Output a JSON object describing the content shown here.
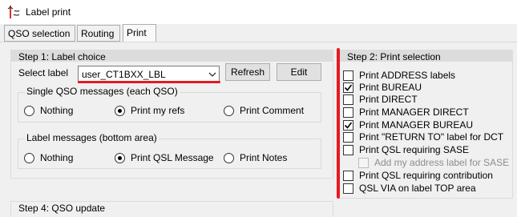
{
  "window": {
    "title": "Label print"
  },
  "tabs": [
    {
      "label": "QSO selection",
      "active": false
    },
    {
      "label": "Routing",
      "active": false
    },
    {
      "label": "Print",
      "active": true
    }
  ],
  "step1": {
    "title": "Step 1: Label choice",
    "select_label": "Select label",
    "selected": "user_CT1BXX_LBL",
    "refresh_label": "Refresh",
    "edit_label": "Edit",
    "single_group": {
      "title": "Single QSO messages (each QSO)",
      "options": [
        {
          "label": "Nothing",
          "checked": false
        },
        {
          "label": "Print my refs",
          "checked": true
        },
        {
          "label": "Print Comment",
          "checked": false
        }
      ]
    },
    "label_group": {
      "title": "Label messages (bottom area)",
      "options": [
        {
          "label": "Nothing",
          "checked": false
        },
        {
          "label": "Print QSL Message",
          "checked": true
        },
        {
          "label": "Print Notes",
          "checked": false
        }
      ]
    }
  },
  "step2": {
    "title": "Step 2: Print selection",
    "items": [
      {
        "label": "Print ADDRESS labels",
        "checked": false,
        "enabled": true
      },
      {
        "label": "Print BUREAU",
        "checked": true,
        "enabled": true
      },
      {
        "label": "Print DIRECT",
        "checked": false,
        "enabled": true
      },
      {
        "label": "Print MANAGER DIRECT",
        "checked": false,
        "enabled": true
      },
      {
        "label": "Print MANAGER BUREAU",
        "checked": true,
        "enabled": true
      },
      {
        "label": "Print \"RETURN TO\" label for DCT",
        "checked": false,
        "enabled": true
      },
      {
        "label": "Print QSL requiring SASE",
        "checked": false,
        "enabled": true
      },
      {
        "label": "Add my address label for SASE",
        "checked": false,
        "enabled": false
      },
      {
        "label": "Print QSL requiring contribution",
        "checked": false,
        "enabled": true
      },
      {
        "label": "QSL VIA on label TOP area",
        "checked": false,
        "enabled": true
      }
    ]
  },
  "step4": {
    "title": "Step 4: QSO update"
  },
  "colors": {
    "highlight": "#e31b23",
    "panel_header": "#dcdcdc",
    "background": "#f0f0f0"
  }
}
